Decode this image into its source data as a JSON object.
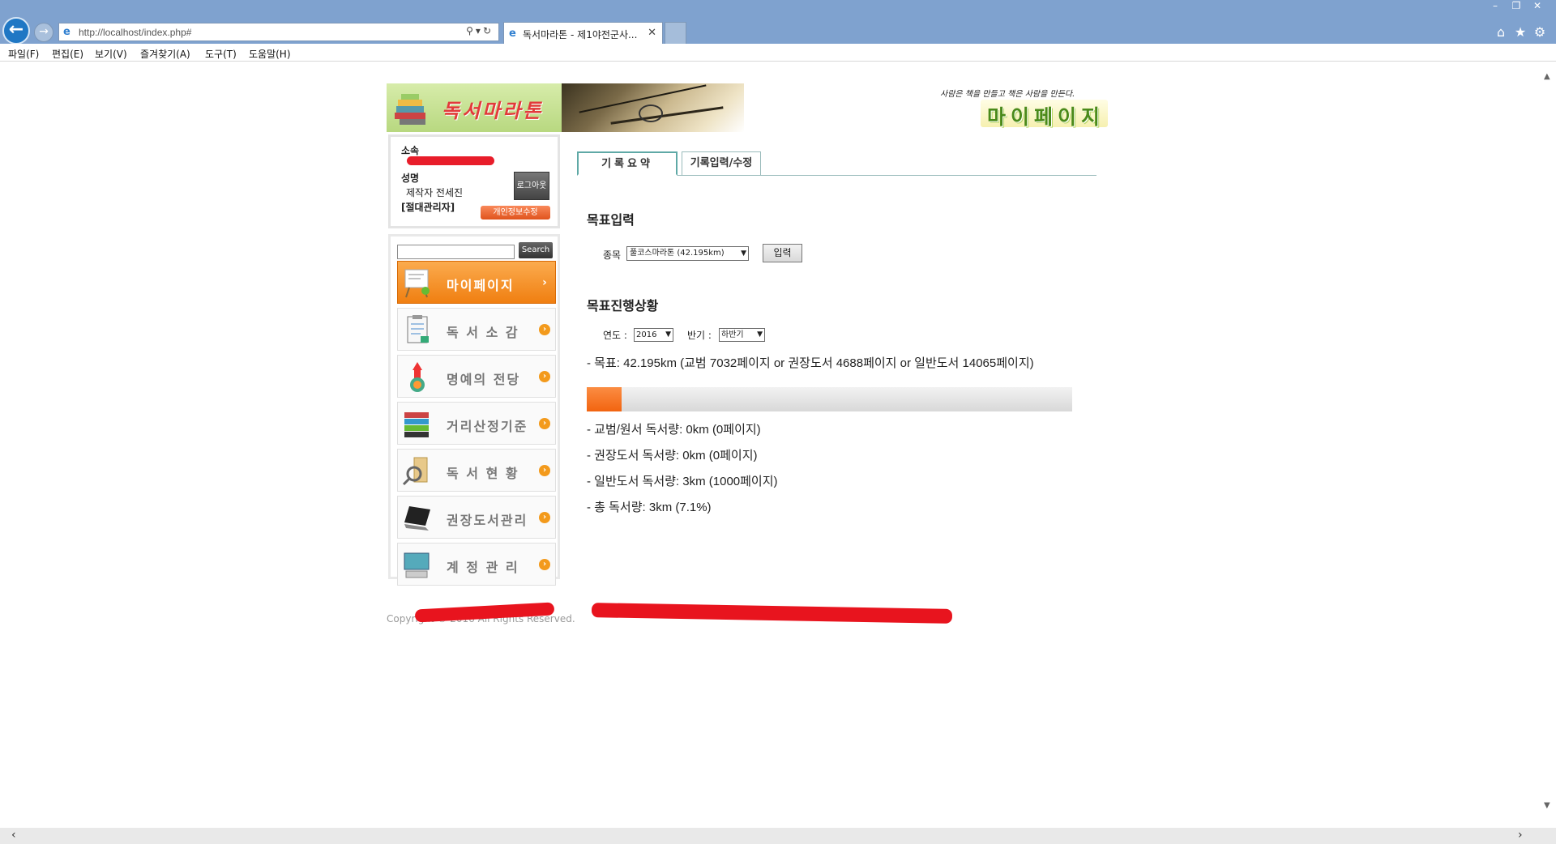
{
  "browser": {
    "url": "http://localhost/index.php#",
    "tab_title": "독서마라톤 - 제1야전군사...",
    "menus": [
      "파일(F)",
      "편집(E)",
      "보기(V)",
      "즐겨찾기(A)",
      "도구(T)",
      "도움말(H)"
    ]
  },
  "header": {
    "logo_text": "독서마라톤",
    "slogan": "사람은 책을 만들고 책은 사람을 만든다.",
    "page_title": "마이페이지"
  },
  "profile": {
    "org_label": "소속",
    "name_label": "성명",
    "name_value": "제작자 전세진",
    "role": "[절대관리자]",
    "logout_label": "로그아웃",
    "edit_info_label": "개인정보수정"
  },
  "search": {
    "button_label": "Search",
    "value": ""
  },
  "sidebar": {
    "items": [
      {
        "label": "마이페이지",
        "icon": "easel-icon",
        "active": true
      },
      {
        "label": "독 서 소 감",
        "icon": "clipboard-icon",
        "active": false
      },
      {
        "label": "명예의 전당",
        "icon": "trophy-icon",
        "active": false
      },
      {
        "label": "거리산정기준",
        "icon": "books-icon",
        "active": false
      },
      {
        "label": "독 서 현 황",
        "icon": "magnifier-icon",
        "active": false
      },
      {
        "label": "권장도서관리",
        "icon": "laptop-icon",
        "active": false
      },
      {
        "label": "계 정 관 리",
        "icon": "monitor-icon",
        "active": false
      }
    ]
  },
  "tabs": [
    {
      "label": "기록요약",
      "active": true
    },
    {
      "label": "기록입력/수정",
      "active": false
    }
  ],
  "goal_input": {
    "heading": "목표입력",
    "kind_label": "종목",
    "kind_selected": "풀코스마라톤 (42.195km)",
    "submit_label": "입력"
  },
  "progress": {
    "heading": "목표진행상황",
    "year_label": "연도 :",
    "year_selected": "2016",
    "half_label": "반기 :",
    "half_selected": "하반기",
    "goal_line": "- 목표: 42.195km (교범 7032페이지 or 권장도서 4688페이지 or 일반도서 14065페이지)",
    "percent": 7.1,
    "stats": [
      "- 교범/원서 독서량: 0km (0페이지)",
      "- 권장도서 독서량: 0km (0페이지)",
      "- 일반도서 독서량: 3km (1000페이지)",
      "- 총 독서량: 3km (7.1%)"
    ]
  },
  "footer": {
    "text": "Copyright © 2016 All Rights Reserved."
  },
  "colors": {
    "accent_orange": "#f07f11",
    "chrome_blue": "#7fa2cf",
    "tab_border": "#5fa9a6",
    "redaction": "#e8141e"
  }
}
